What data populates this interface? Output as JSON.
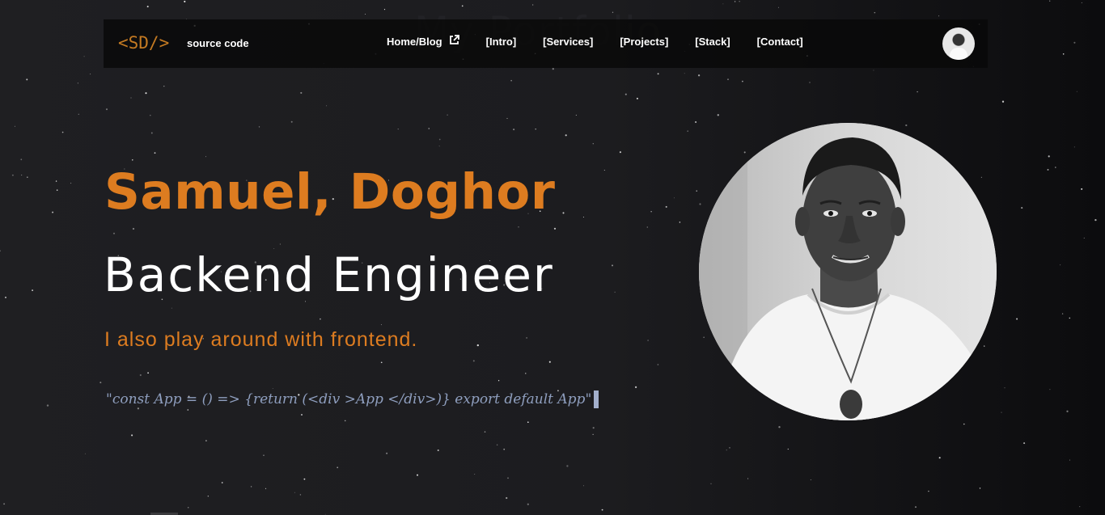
{
  "background_title": "My Portfolio",
  "navbar": {
    "logo": "<SD/>",
    "brand_label": "source code",
    "links": [
      {
        "label": "Home/Blog",
        "icon": "external-link-icon"
      },
      {
        "label": "[Intro]"
      },
      {
        "label": "[Services]"
      },
      {
        "label": "[Projects]"
      },
      {
        "label": "[Stack]"
      },
      {
        "label": "[Contact]"
      }
    ],
    "avatar_icon": "profile-avatar"
  },
  "hero": {
    "name": "Samuel, Doghor",
    "role": "Backend Engineer",
    "tagline": "I also play around with frontend.",
    "code_snippet": "\"const App = () => {return (<div >App </div>)} export default App\""
  },
  "colors": {
    "accent": "#dd7c20",
    "text": "#ffffff",
    "code": "#8f9fbf",
    "background": "#1c1c1f"
  }
}
